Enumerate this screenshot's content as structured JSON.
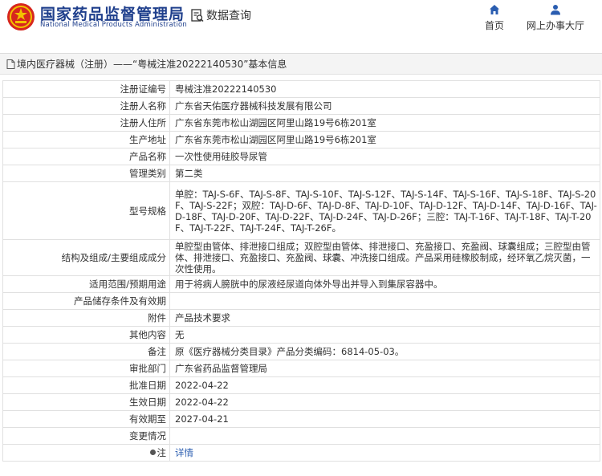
{
  "header": {
    "title": "国家药品监督管理局",
    "subtitle": "National Medical Products Administration",
    "query_label": "数据查询",
    "nav": [
      {
        "label": "首页",
        "icon": "home-icon"
      },
      {
        "label": "网上办事大厅",
        "icon": "person-icon"
      }
    ]
  },
  "breadcrumb": {
    "text": "境内医疗器械（注册）——“粤械注准20222140530”基本信息"
  },
  "colors": {
    "brand": "#1f3f8c",
    "link": "#2a5db0",
    "nav_icon": "#2a5db0"
  },
  "rows": [
    {
      "label": "注册证编号",
      "value": "粤械注准20222140530"
    },
    {
      "label": "注册人名称",
      "value": "广东省天佑医疗器械科技发展有限公司"
    },
    {
      "label": "注册人住所",
      "value": "广东省东莞市松山湖园区阿里山路19号6栋201室"
    },
    {
      "label": "生产地址",
      "value": "广东省东莞市松山湖园区阿里山路19号6栋201室"
    },
    {
      "label": "产品名称",
      "value": "一次性使用硅胶导尿管"
    },
    {
      "label": "管理类别",
      "value": "第二类"
    },
    {
      "label": "型号规格",
      "value": "单腔：TAJ-S-6F、TAJ-S-8F、TAJ-S-10F、TAJ-S-12F、TAJ-S-14F、TAJ-S-16F、TAJ-S-18F、TAJ-S-20F、TAJ-S-22F；双腔：TAJ-D-6F、TAJ-D-8F、TAJ-D-10F、TAJ-D-12F、TAJ-D-14F、TAJ-D-16F、TAJ-D-18F、TAJ-D-20F、TAJ-D-22F、TAJ-D-24F、TAJ-D-26F；三腔：TAJ-T-16F、TAJ-T-18F、TAJ-T-20F、TAJ-T-22F、TAJ-T-24F、TAJ-T-26F。"
    },
    {
      "label": "结构及组成/主要组成成分",
      "value": "单腔型由管体、排泄接口组成；双腔型由管体、排泄接口、充盈接口、充盈阀、球囊组成；三腔型由管体、排泄接口、充盈接口、充盈阀、球囊、冲洗接口组成。产品采用硅橡胶制成，经环氧乙烷灭菌，一次性使用。"
    },
    {
      "label": "适用范围/预期用途",
      "value": "用于将病人膀胱中的尿液经尿道向体外导出并导入到集尿容器中。"
    },
    {
      "label": "产品储存条件及有效期",
      "value": ""
    },
    {
      "label": "附件",
      "value": "产品技术要求"
    },
    {
      "label": "其他内容",
      "value": "无"
    },
    {
      "label": "备注",
      "value": "原《医疗器械分类目录》产品分类编码：6814-05-03。"
    },
    {
      "label": "审批部门",
      "value": "广东省药品监督管理局"
    },
    {
      "label": "批准日期",
      "value": "2022-04-22"
    },
    {
      "label": "生效日期",
      "value": "2022-04-22"
    },
    {
      "label": "有效期至",
      "value": "2027-04-21"
    },
    {
      "label": "变更情况",
      "value": ""
    },
    {
      "label": "注",
      "value": "详情"
    }
  ]
}
